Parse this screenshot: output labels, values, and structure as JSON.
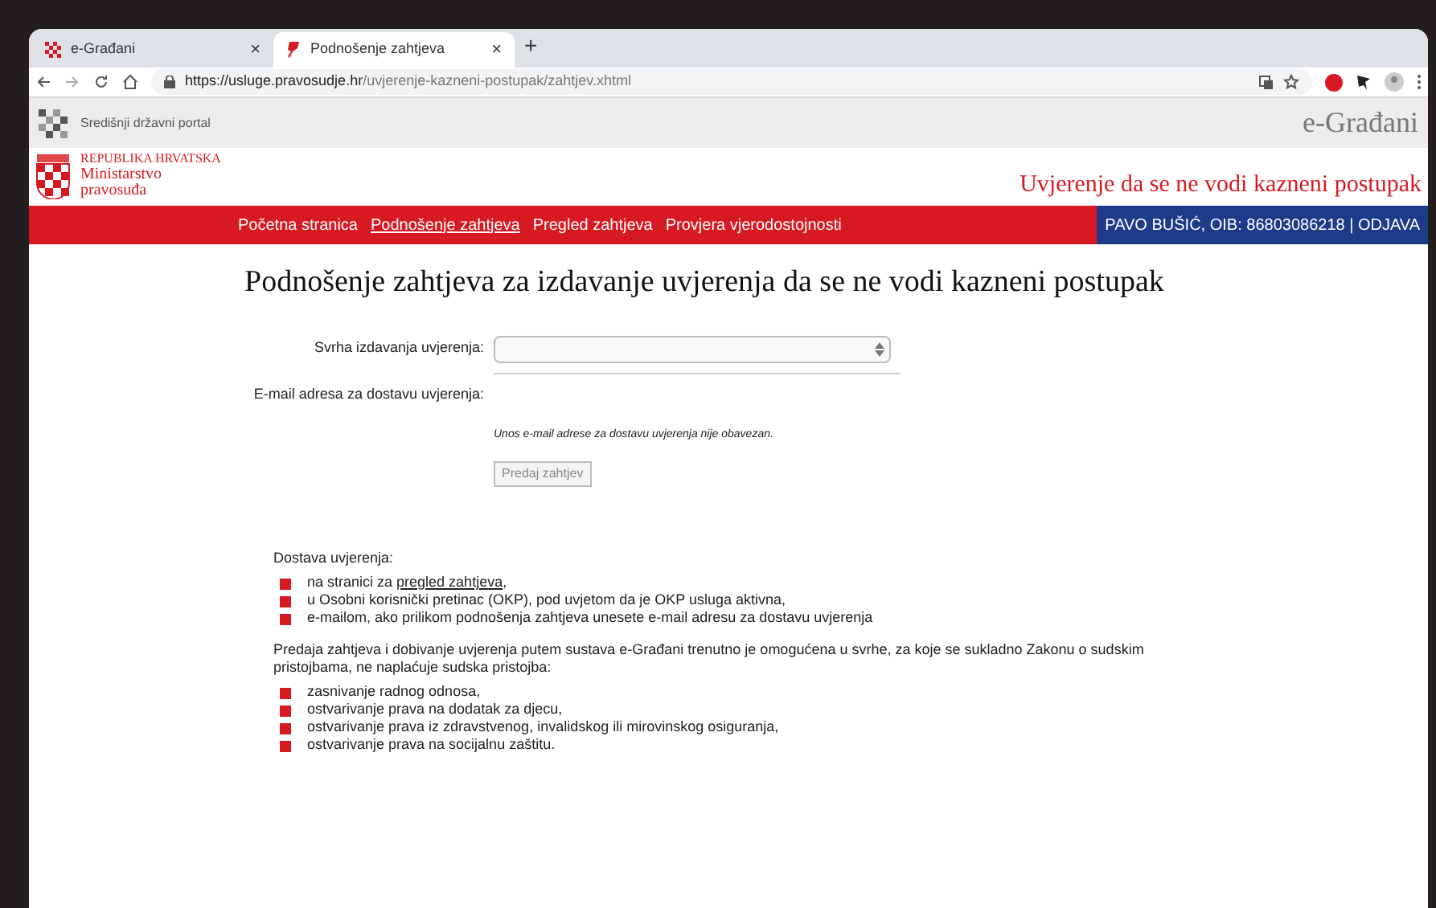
{
  "browser": {
    "tabs": [
      {
        "title": "e-Građani",
        "selected": false,
        "close": "×"
      },
      {
        "title": "Podnošenje zahtjeva",
        "selected": true,
        "close": "×"
      }
    ],
    "new_tab": "+",
    "url_host": "https://usluge.pravosudje.hr",
    "url_path": "/uvjerenje-kazneni-postupak/zahtjev.xhtml"
  },
  "portal_bar": {
    "title": "Središnji državni portal",
    "brand": "e-Građani"
  },
  "header": {
    "org_lines": [
      "REPUBLIKA HRVATSKA",
      "Ministarstvo",
      "pravosuđa"
    ],
    "service_title": "Uvjerenje da se ne vodi kazneni postupak"
  },
  "nav": {
    "items": [
      {
        "label": "Početna stranica",
        "selected": false
      },
      {
        "label": "Podnošenje zahtjeva",
        "selected": true
      },
      {
        "label": "Pregled zahtjeva",
        "selected": false
      },
      {
        "label": "Provjera vjerodostojnosti",
        "selected": false
      }
    ],
    "user": "PAVO BUŠIĆ, OIB: 86803086218 | ODJAVA"
  },
  "page_title": "Podnošenje zahtjeva za izdavanje uvjerenja da se ne vodi kazneni postupak",
  "form": {
    "purpose_label": "Svrha izdavanja uvjerenja:",
    "email_label": "E-mail adresa za dostavu uvjerenja:",
    "email_note": "Unos e-mail adrese za dostavu uvjerenja nije obavezan.",
    "submit": "Predaj zahtjev",
    "submit_disabled": true
  },
  "delivery": {
    "heading": "Dostava uvjerenja:",
    "items": [
      {
        "text": "na stranici za ",
        "link": "pregled zahtjeva",
        "after": ","
      },
      {
        "text": "u Osobni korisnički pretinac (OKP), pod uvjetom da je OKP usluga aktivna,"
      },
      {
        "text": "e-mailom, ako prilikom podnošenja zahtjeva unesete e-mail adresu za dostavu uvjerenja"
      }
    ]
  },
  "purposes": {
    "intro": "Predaja zahtjeva i dobivanje uvjerenja putem sustava e-Građani trenutno je omogućena u svrhe, za koje se sukladno Zakonu o sudskim pristojbama, ne naplaćuje sudska pristojba:",
    "items": [
      "zasnivanje radnog odnosa,",
      "ostvarivanje prava na dodatak za djecu,",
      "ostvarivanje prava iz zdravstvenog, invalidskog ili mirovinskog osiguranja,",
      "ostvarivanje prava na socijalnu zaštitu."
    ]
  }
}
